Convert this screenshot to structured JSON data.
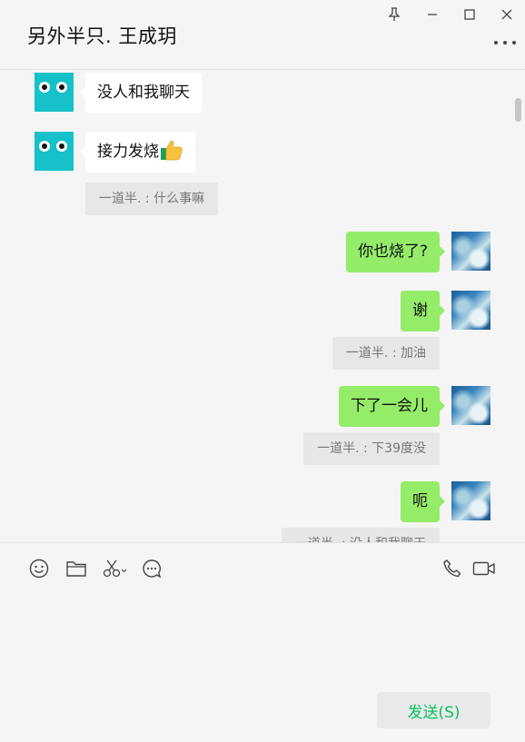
{
  "window": {
    "title": "另外半只. 王成玥"
  },
  "controls": {
    "pin_icon": "pin-icon",
    "minimize_icon": "minimize-icon",
    "maximize_icon": "maximize-icon",
    "close_icon": "close-icon",
    "more_icon": "more-icon"
  },
  "messages": [
    {
      "side": "left",
      "type": "text",
      "text": "没人和我聊天"
    },
    {
      "side": "left",
      "type": "text",
      "text": "接力发烧",
      "emoji": "thumbs-up"
    },
    {
      "side": "left",
      "type": "quote",
      "text": "一道半. : 什么事嘛"
    },
    {
      "side": "right",
      "type": "text",
      "text": "你也烧了?"
    },
    {
      "side": "right",
      "type": "text",
      "text": "谢"
    },
    {
      "side": "right",
      "type": "quote",
      "text": "一道半. : 加油"
    },
    {
      "side": "right",
      "type": "text",
      "text": "下了一会儿"
    },
    {
      "side": "right",
      "type": "quote",
      "text": "一道半. : 下39度没"
    },
    {
      "side": "right",
      "type": "text",
      "text": "呃"
    },
    {
      "side": "right",
      "type": "quote",
      "text": "一道半. : 没人和我聊天"
    }
  ],
  "toolbar": {
    "emoji_icon": "emoji-icon",
    "folder_icon": "folder-icon",
    "scissors_icon": "scissors-icon",
    "chat_history_icon": "chat-history-icon",
    "phone_icon": "phone-icon",
    "video_icon": "video-call-icon"
  },
  "composer": {
    "input_value": "",
    "send_label": "发送(S)"
  },
  "colors": {
    "own_bubble": "#95ec69",
    "other_bubble": "#ffffff",
    "send_text": "#07c160",
    "avatar_other": "#16c1c9"
  }
}
